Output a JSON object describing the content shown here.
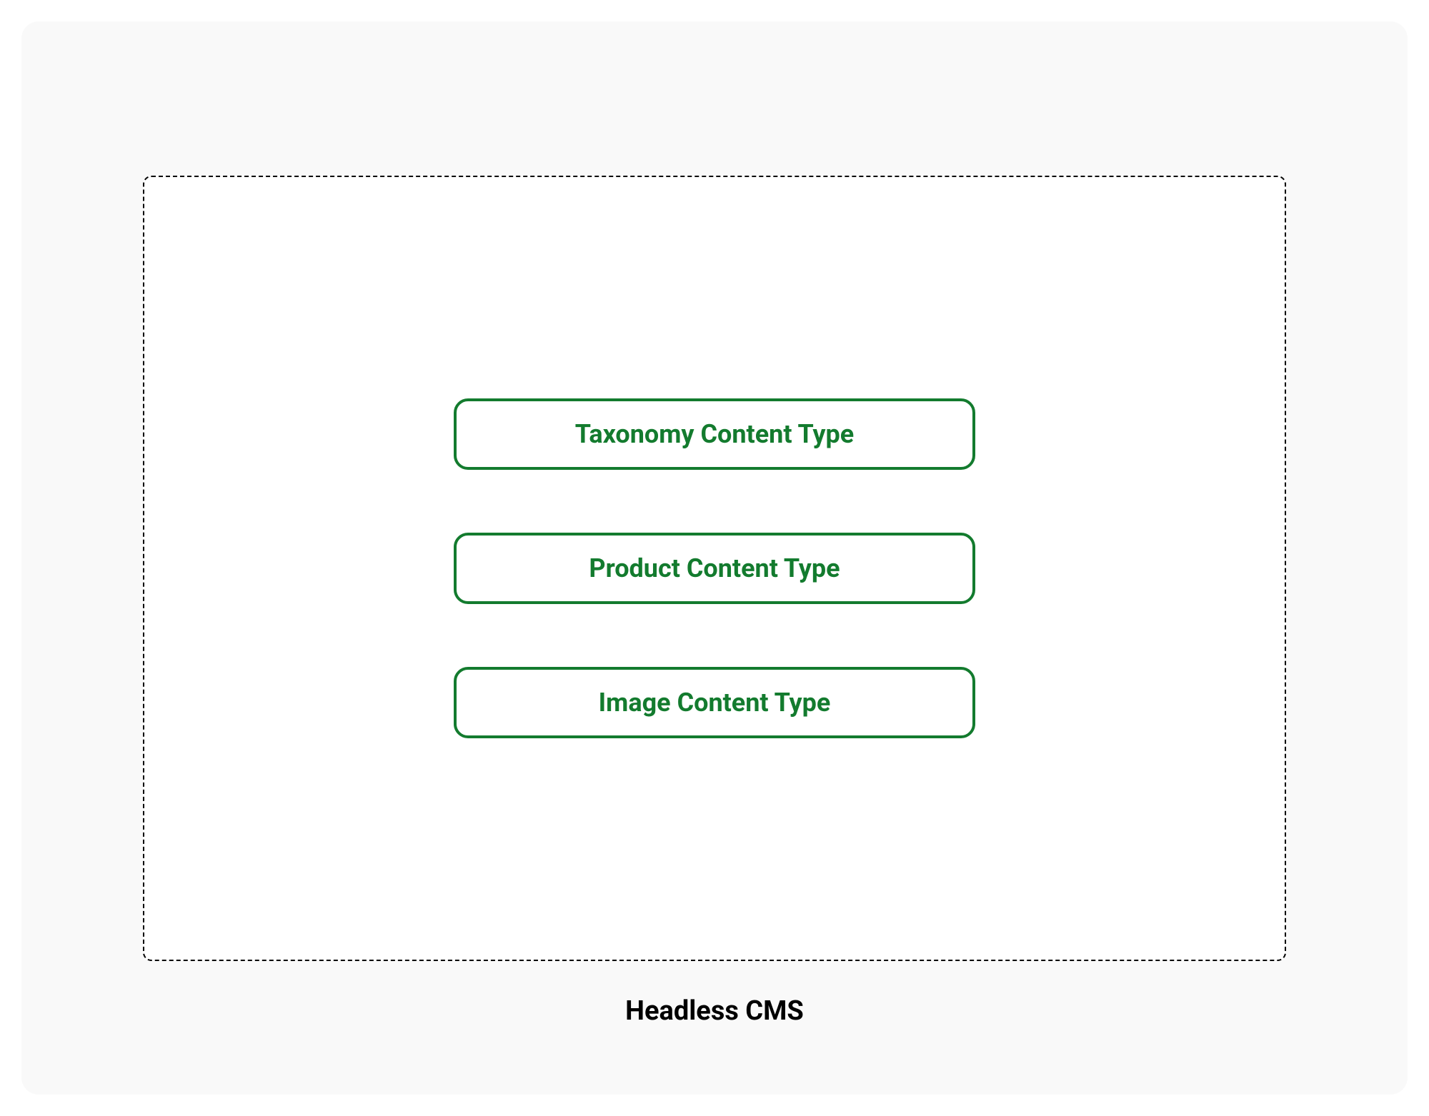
{
  "diagram": {
    "container_label": "Headless CMS",
    "content_types": [
      {
        "label": "Taxonomy Content Type"
      },
      {
        "label": "Product Content Type"
      },
      {
        "label": "Image Content Type"
      }
    ]
  }
}
